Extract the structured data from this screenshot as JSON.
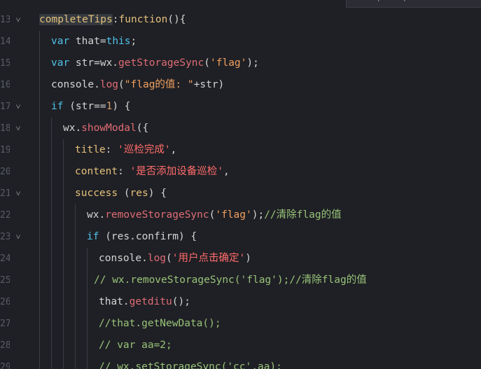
{
  "breadcrumb_tab": {
    "arrow": ">",
    "label": "completeTips"
  },
  "lines": [
    {
      "n": "",
      "fold": "",
      "text_parts": [
        [
          "pn",
          "};"
        ]
      ]
    },
    {
      "n": "13",
      "fold": "v",
      "text_parts": [
        [
          "fnsel",
          "completeTips"
        ],
        [
          "plain",
          ":"
        ],
        [
          "fn",
          "function"
        ],
        [
          "plain",
          "(){"
        ]
      ]
    },
    {
      "n": "14",
      "fold": "",
      "text_parts": [
        [
          "kw",
          "var"
        ],
        [
          "plain",
          " that="
        ],
        [
          "kw",
          "this"
        ],
        [
          "plain",
          ";"
        ]
      ]
    },
    {
      "n": "15",
      "fold": "",
      "text_parts": [
        [
          "kw",
          "var"
        ],
        [
          "plain",
          " str=wx."
        ],
        [
          "call",
          "getStorageSync"
        ],
        [
          "plain",
          "("
        ],
        [
          "str",
          "'flag'"
        ],
        [
          "plain",
          ");"
        ]
      ]
    },
    {
      "n": "16",
      "fold": "",
      "text_parts": [
        [
          "plain",
          "console."
        ],
        [
          "call",
          "log"
        ],
        [
          "plain",
          "("
        ],
        [
          "str",
          "\"flag的值: \""
        ],
        [
          "plain",
          "+str)"
        ]
      ]
    },
    {
      "n": "17",
      "fold": "v",
      "text_parts": [
        [
          "kw",
          "if"
        ],
        [
          "plain",
          " (str=="
        ],
        [
          "num",
          "1"
        ],
        [
          "plain",
          ") {"
        ]
      ]
    },
    {
      "n": "18",
      "fold": "v",
      "text_parts": [
        [
          "plain",
          "wx."
        ],
        [
          "call",
          "showModal"
        ],
        [
          "plain",
          "({"
        ]
      ]
    },
    {
      "n": "19",
      "fold": "",
      "text_parts": [
        [
          "prop",
          "title"
        ],
        [
          "plain",
          ": "
        ],
        [
          "strcn",
          "'巡检完成'"
        ],
        [
          "plain",
          ","
        ]
      ]
    },
    {
      "n": "20",
      "fold": "",
      "text_parts": [
        [
          "prop",
          "content"
        ],
        [
          "plain",
          ": "
        ],
        [
          "strcn",
          "'是否添加设备巡检'"
        ],
        [
          "plain",
          ","
        ]
      ]
    },
    {
      "n": "21",
      "fold": "v",
      "text_parts": [
        [
          "fn",
          "success"
        ],
        [
          "plain",
          " ("
        ],
        [
          "pn",
          "res"
        ],
        [
          "plain",
          ") {"
        ]
      ]
    },
    {
      "n": "22",
      "fold": "",
      "text_parts": [
        [
          "plain",
          "wx."
        ],
        [
          "call",
          "removeStorageSync"
        ],
        [
          "plain",
          "("
        ],
        [
          "str",
          "'flag'"
        ],
        [
          "plain",
          ");"
        ],
        [
          "cmt",
          "//清除flag的值"
        ]
      ]
    },
    {
      "n": "23",
      "fold": "v",
      "text_parts": [
        [
          "kw",
          "if"
        ],
        [
          "plain",
          " (res.confirm) {"
        ]
      ]
    },
    {
      "n": "24",
      "fold": "",
      "text_parts": [
        [
          "plain",
          "console."
        ],
        [
          "call",
          "log"
        ],
        [
          "plain",
          "("
        ],
        [
          "strcn",
          "'用户点击确定'"
        ],
        [
          "plain",
          ")"
        ]
      ]
    },
    {
      "n": "25",
      "fold": "",
      "text_parts": [
        [
          "cmt",
          "// wx.removeStorageSync('flag');//清除flag的值"
        ]
      ]
    },
    {
      "n": "26",
      "fold": "",
      "text_parts": [
        [
          "plain",
          "that."
        ],
        [
          "call",
          "getditu"
        ],
        [
          "plain",
          "();"
        ]
      ]
    },
    {
      "n": "27",
      "fold": "",
      "text_parts": [
        [
          "cmt",
          "//that.getNewData();"
        ]
      ]
    },
    {
      "n": "28",
      "fold": "",
      "text_parts": [
        [
          "cmt",
          "// var aa=2;"
        ]
      ]
    },
    {
      "n": "29",
      "fold": "",
      "text_parts": [
        [
          "cmt",
          "// wx.setStorageSync('cc',aa);"
        ]
      ]
    }
  ]
}
